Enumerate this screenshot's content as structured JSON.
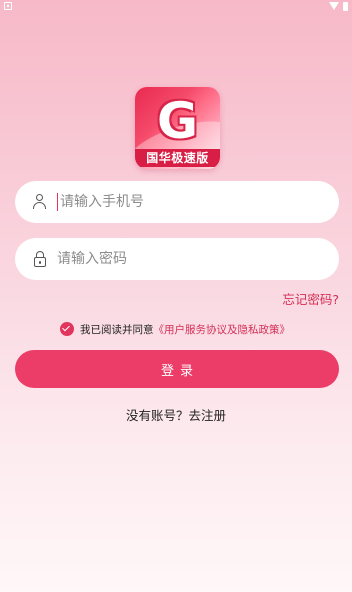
{
  "app": {
    "logo_text": "G",
    "logo_caption": "国华极速版"
  },
  "form": {
    "phone_placeholder": "请输入手机号",
    "password_placeholder": "请输入密码",
    "forgot_password": "忘记密码?",
    "agreement_prefix": "我已阅读并同意",
    "agreement_link": "《用户服务协议及隐私政策》",
    "agreement_checked": true,
    "login_button": "登录",
    "register_link": "没有账号？去注册"
  },
  "colors": {
    "accent": "#ec3c68",
    "link": "#d42e55"
  }
}
